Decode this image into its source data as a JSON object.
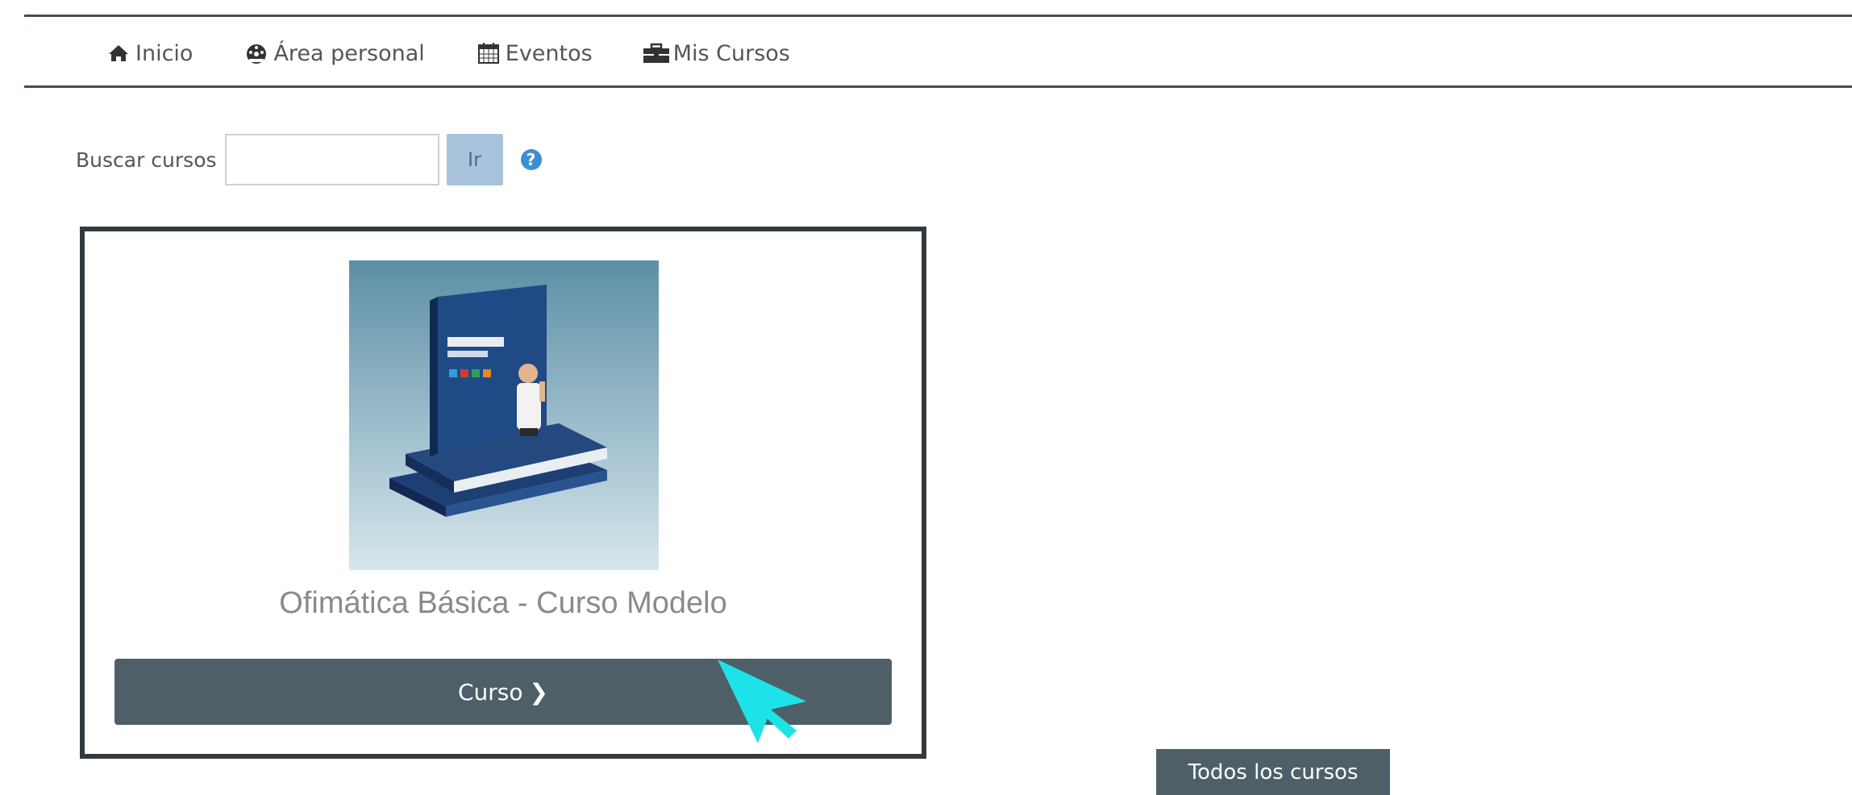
{
  "nav": {
    "items": [
      {
        "label": "Inicio",
        "icon": "home-icon"
      },
      {
        "label": "Área personal",
        "icon": "dashboard-icon"
      },
      {
        "label": "Eventos",
        "icon": "calendar-icon"
      },
      {
        "label": "Mis Cursos",
        "icon": "briefcase-icon"
      }
    ]
  },
  "search": {
    "label": "Buscar cursos",
    "value": "",
    "placeholder": "",
    "button_label": "Ir",
    "help_glyph": "?"
  },
  "course": {
    "title": "Ofimática Básica - Curso Modelo",
    "button_label": "Curso",
    "button_chevron": "❯",
    "image_alt": "book-cover"
  },
  "all_courses_label": "Todos los cursos",
  "colors": {
    "nav_line": "#3f4f59",
    "button_bg": "#4f5f67",
    "search_button_bg": "#a9c3dc",
    "help_icon": "#3d8ed3",
    "cursor": "#1de3e8"
  }
}
